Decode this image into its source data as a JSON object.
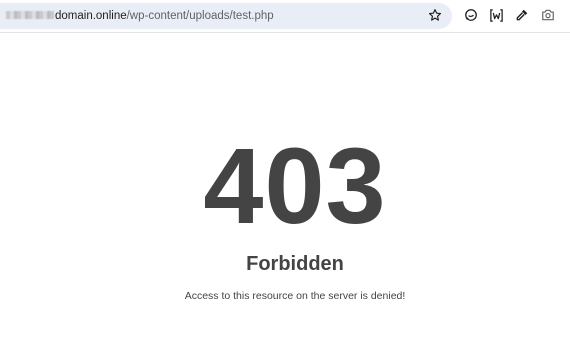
{
  "browser": {
    "address_bar": {
      "host": "domain.online",
      "path": "/wp-content/uploads/test.php"
    },
    "icons": {
      "bookmark": "star-icon",
      "extension_1": "chat-extension-icon",
      "extension_2": "w-extension-icon",
      "extension_3": "eyedropper-icon",
      "extension_4": "camera-icon"
    }
  },
  "page": {
    "status_code": "403",
    "status_title": "Forbidden",
    "message": "Access to this resource on the server is denied!"
  },
  "colors": {
    "text": "#444444",
    "omnibox_bg": "#e9eef6"
  }
}
